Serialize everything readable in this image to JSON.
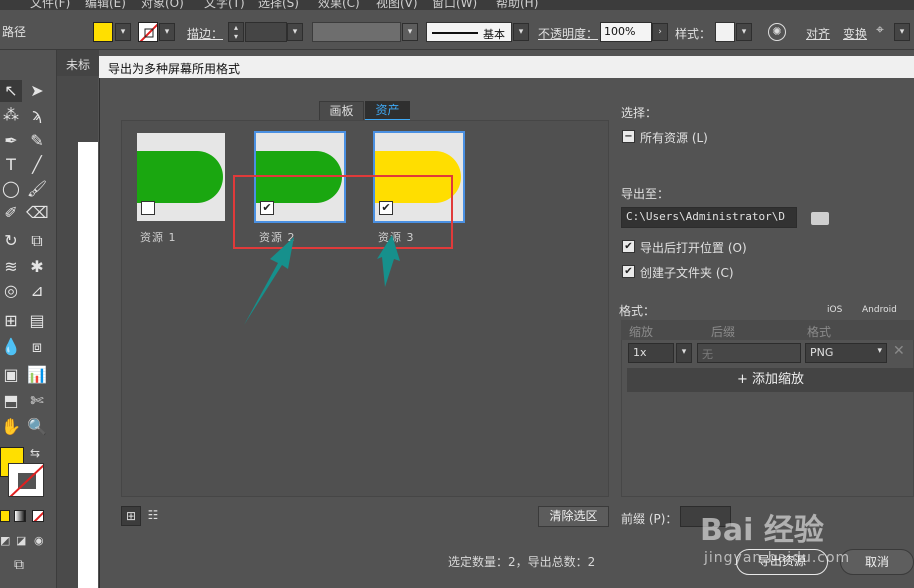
{
  "menubar": {
    "items": [
      "文件(F)",
      "编辑(E)",
      "对象(O)",
      "文字(T)",
      "选择(S)",
      "效果(C)",
      "视图(V)",
      "窗口(W)",
      "帮助(H)"
    ]
  },
  "control_bar": {
    "path_label": "路径",
    "stroke_label": "描边：",
    "brush_style": "基本",
    "opacity_label": "不透明度：",
    "opacity_value": "100%",
    "style_label": "样式：",
    "align_label": "对齐",
    "transform_label": "变换"
  },
  "document": {
    "tab_label": "未标题"
  },
  "dialog": {
    "title": "导出为多种屏幕所用格式",
    "tabs": [
      "画板",
      "资产"
    ],
    "active_tab": "资产",
    "assets": [
      {
        "name": "资源 1",
        "checked": false,
        "color": "#1aa710",
        "selected": false
      },
      {
        "name": "资源 2",
        "checked": true,
        "color": "#1aa710",
        "selected": true
      },
      {
        "name": "资源 3",
        "checked": true,
        "color": "#ffde00",
        "selected": true
      }
    ],
    "clear_selection": "清除选区",
    "selection_summary": "选定数量：2，导出总数：2",
    "select_label": "选择：",
    "all_assets_label": "所有资源 (L)",
    "export_to_label": "导出至：",
    "export_path": "C:\\Users\\Administrator\\D",
    "open_after_export": "导出后打开位置 (O)",
    "create_subfolders": "创建子文件夹 (C)",
    "format_label": "格式：",
    "ios_label": "iOS",
    "android_label": "Android",
    "col_scale": "缩放",
    "col_suffix": "后缀",
    "col_format": "格式",
    "scale_value": "1x",
    "suffix_placeholder": "无",
    "format_value": "PNG",
    "add_scale": "添加缩放",
    "prefix_label": "前缀 (P)：",
    "export_button": "导出资源",
    "cancel_button": "取消"
  },
  "watermark": {
    "brand": "Bai 经验",
    "url": "jingyan.baidu.com"
  }
}
